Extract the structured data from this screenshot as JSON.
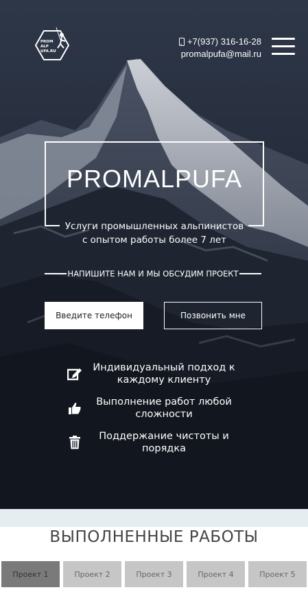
{
  "header": {
    "logo_text": [
      "PROM",
      "ALP",
      "UFA.RU"
    ],
    "phone": "+7(937) 316-16-28",
    "email": "promalpufa@mail.ru",
    "phone_icon": "phone-icon",
    "menu_icon": "hamburger-menu-icon"
  },
  "hero": {
    "brand": "PROMALPUFA",
    "subtitle_line1": "Услуги промышленных альпинистов",
    "subtitle_line2": "с опытом работы более 7 лет",
    "cta_text": "НАПИШИТЕ НАМ И МЫ ОБСУДИМ ПРОЕКТ",
    "phone_placeholder": "Введите телефон",
    "call_button": "Позвонить мне"
  },
  "features": [
    {
      "icon": "edit-icon",
      "line1": "Индивидуальный подход к",
      "line2": "каждому клиенту"
    },
    {
      "icon": "thumbs-up-icon",
      "line1": "Выполнение работ любой",
      "line2": "сложности"
    },
    {
      "icon": "trash-icon",
      "line1": "Поддержание чистоты и",
      "line2": "порядка"
    }
  ],
  "works": {
    "title": "ВЫПОЛНЕННЫЕ РАБОТЫ",
    "tabs": [
      "Проект 1",
      "Проект 2",
      "Проект 3",
      "Проект 4",
      "Проект 5"
    ],
    "active_tab": 0
  },
  "colors": {
    "hero_bg": "#1f2533",
    "accent_white": "#ffffff",
    "tab_active": "#7a7a7a",
    "tab_inactive": "#c6c6c6",
    "strip": "#e6edf0"
  }
}
